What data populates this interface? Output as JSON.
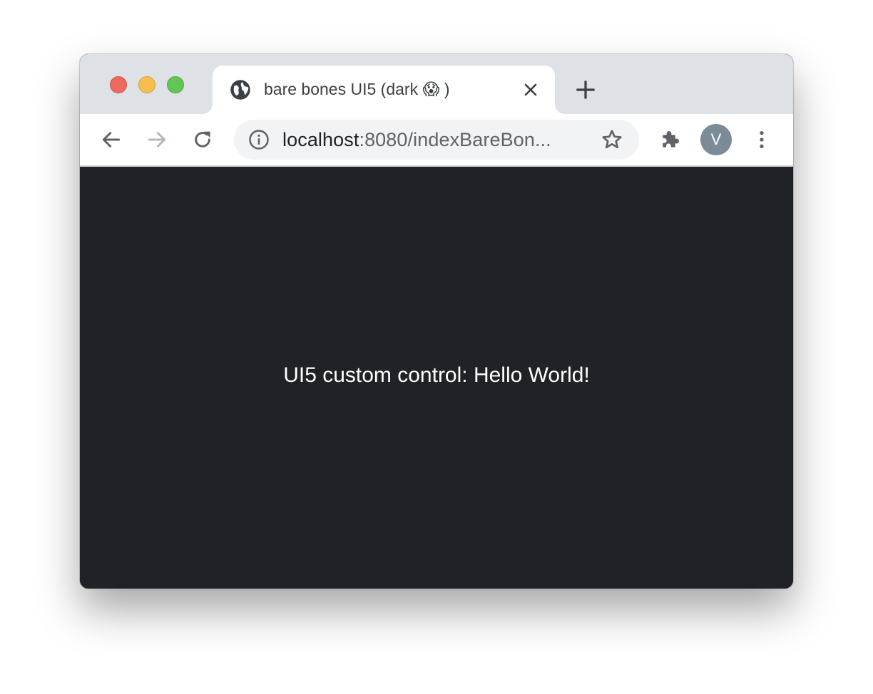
{
  "window": {
    "tab": {
      "title": "bare bones UI5 (dark 😱 )",
      "favicon": "globe-icon",
      "close_icon": "close-icon"
    },
    "new_tab_icon": "plus-icon"
  },
  "toolbar": {
    "back_icon": "arrow-left-icon",
    "forward_icon": "arrow-right-icon",
    "reload_icon": "reload-icon",
    "omnibox": {
      "info_icon": "info-icon",
      "url_host": "localhost",
      "url_rest": ":8080/indexBareBon...",
      "star_icon": "star-icon"
    },
    "extensions_icon": "puzzle-icon",
    "profile_initial": "V",
    "menu_icon": "kebab-menu-icon"
  },
  "page": {
    "text": "UI5 custom control: Hello World!",
    "background": "#1f2226",
    "text_color": "#ffffff"
  },
  "colors": {
    "titlebar": "#dee1e6",
    "traffic_red": "#ee6a5f",
    "traffic_yellow": "#f5be4f",
    "traffic_green": "#62c655",
    "avatar": "#7b8b98"
  }
}
